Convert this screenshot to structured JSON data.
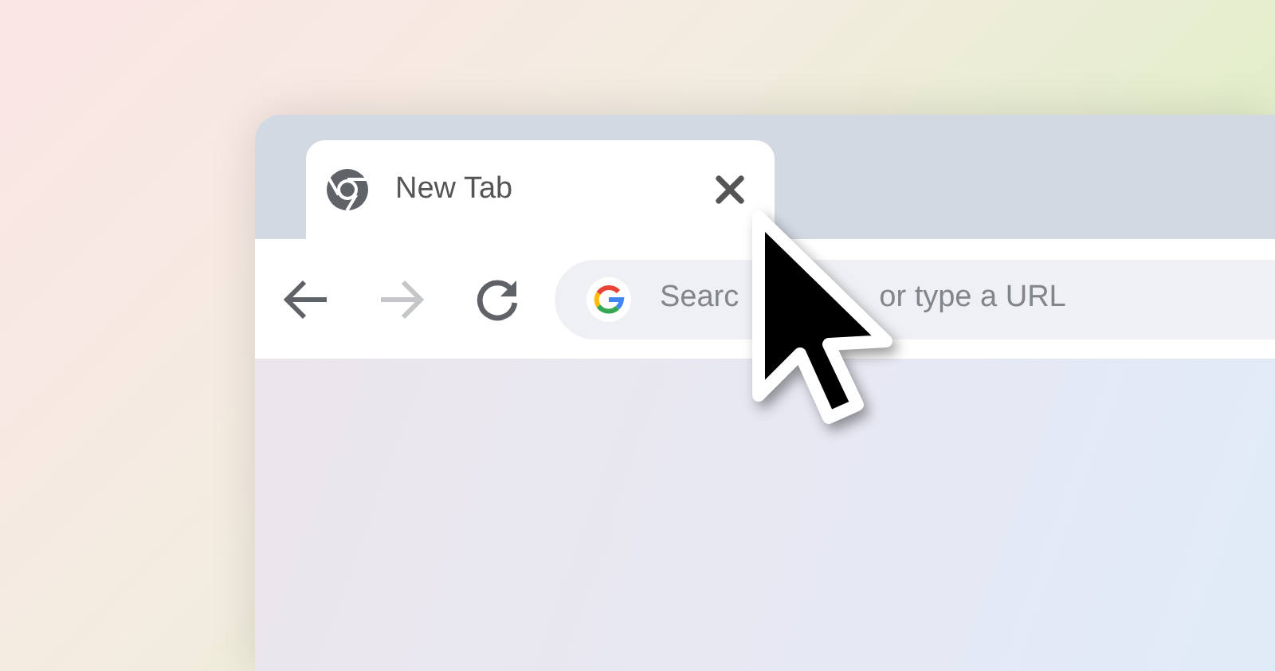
{
  "tabs": [
    {
      "title": "New Tab",
      "selected": true
    }
  ],
  "toolbar": {
    "buttons": [
      {
        "kind": "back",
        "disabled": false
      },
      {
        "kind": "forward",
        "disabled": true
      },
      {
        "kind": "reload",
        "disabled": false
      }
    ]
  },
  "omnibox": {
    "text_before_cursor": "Searc",
    "text_after_cursor": "or type a URL"
  }
}
